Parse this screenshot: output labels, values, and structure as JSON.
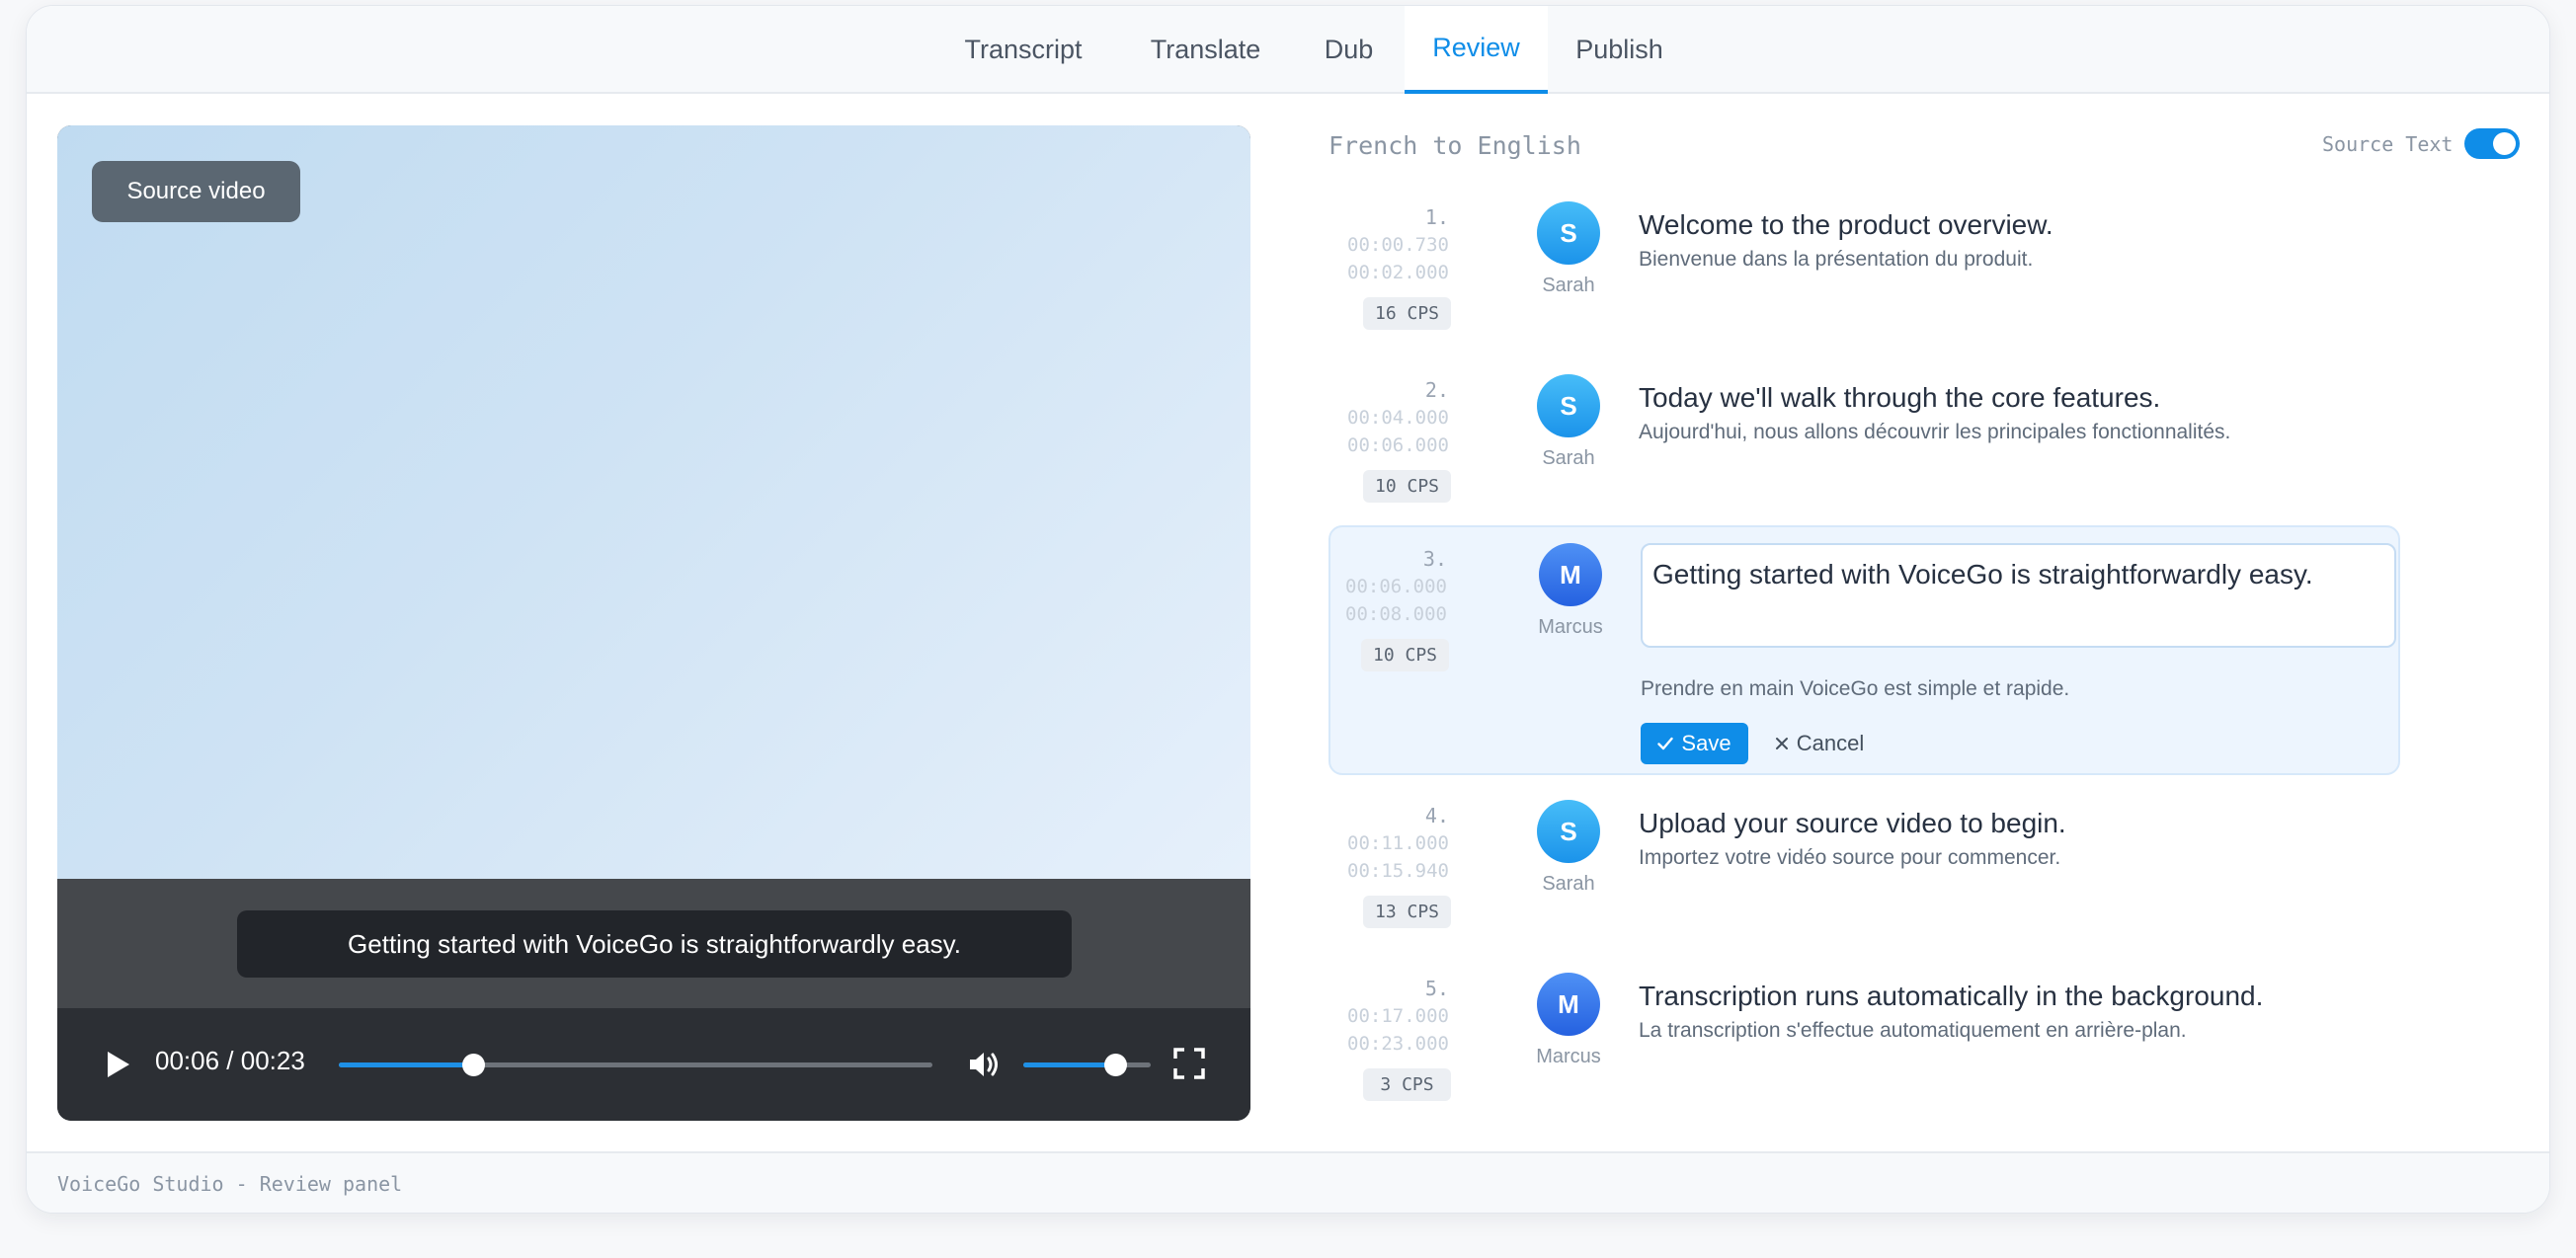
{
  "tabs": [
    {
      "label": "Transcript",
      "active": false
    },
    {
      "label": "Translate",
      "active": false
    },
    {
      "label": "Dub",
      "active": false
    },
    {
      "label": "Review",
      "active": true
    },
    {
      "label": "Publish",
      "active": false
    }
  ],
  "player": {
    "badge": "Source video",
    "subtitle": "Getting started with VoiceGo is straightforwardly easy.",
    "time_display": "00:06 / 00:23",
    "progress_fraction": 0.226,
    "volume_fraction": 0.72
  },
  "panel": {
    "title": "French to English",
    "source_toggle_label": "Source Text",
    "source_toggle_on": true
  },
  "segments": [
    {
      "number": "1.",
      "start": "00:00.730",
      "end": "00:02.000",
      "cps": "16 CPS",
      "avatar_letter": "S",
      "speaker": "Sarah",
      "text": "Welcome to the product overview.",
      "source": "Bienvenue dans la présentation du produit."
    },
    {
      "number": "2.",
      "start": "00:04.000",
      "end": "00:06.000",
      "cps": "10 CPS",
      "avatar_letter": "S",
      "speaker": "Sarah",
      "text": "Today we'll walk through the core features.",
      "source": "Aujourd'hui, nous allons découvrir les principales fonctionnalités."
    },
    {
      "number": "3.",
      "start": "00:06.000",
      "end": "00:08.000",
      "cps": "10 CPS",
      "avatar_letter": "M",
      "speaker": "Marcus",
      "text": "Getting started with VoiceGo is straightforwardly easy.",
      "source": "Prendre en main VoiceGo est simple et rapide."
    },
    {
      "number": "4.",
      "start": "00:11.000",
      "end": "00:15.940",
      "cps": "13 CPS",
      "avatar_letter": "S",
      "speaker": "Sarah",
      "text": "Upload your source video to begin.",
      "source": "Importez votre vidéo source pour commencer."
    },
    {
      "number": "5.",
      "start": "00:17.000",
      "end": "00:23.000",
      "cps": "3 CPS",
      "avatar_letter": "M",
      "speaker": "Marcus",
      "text": "Transcription runs automatically in the background.",
      "source": "La transcription s'effectue automatiquement en arrière-plan."
    }
  ],
  "editor": {
    "save_label": "Save",
    "cancel_label": "Cancel"
  },
  "footer": {
    "text": "VoiceGo Studio - Review panel"
  },
  "colors": {
    "accent": "#0f8de8",
    "avatar_sarah": "#1b93ea",
    "avatar_marcus": "#2561e0"
  }
}
